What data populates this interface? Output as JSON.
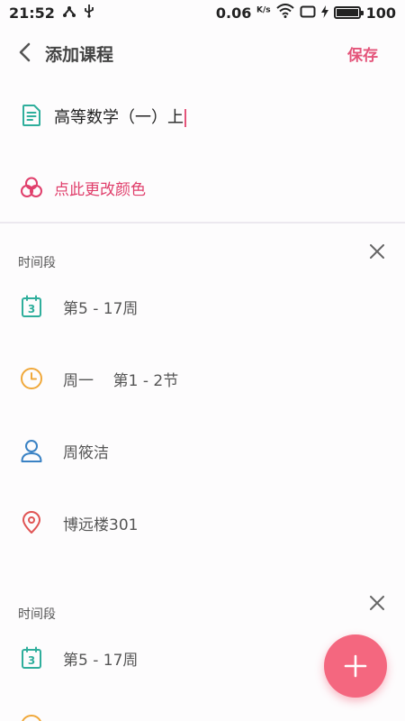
{
  "status_bar": {
    "time": "21:52",
    "net_speed": "0.06",
    "net_speed_unit": "K/s",
    "battery": "100",
    "battery_level": 1.0
  },
  "header": {
    "title": "添加课程",
    "save_label": "保存"
  },
  "course": {
    "name": "高等数学（一）上",
    "change_color_label": "点此更改颜色"
  },
  "sections": [
    {
      "label": "时间段",
      "weeks": "第5 - 17周",
      "time": "周一    第1 - 2节",
      "teacher": "周筱洁",
      "location": "博远楼301"
    },
    {
      "label": "时间段",
      "weeks": "第5 - 17周"
    }
  ],
  "calendar_icon_number": "3",
  "colors": {
    "accent": "#e4547a",
    "teal": "#2fae9c",
    "orange": "#f0a83a",
    "blue": "#3a82c4",
    "red": "#e05454",
    "fab": "#f4677f"
  }
}
